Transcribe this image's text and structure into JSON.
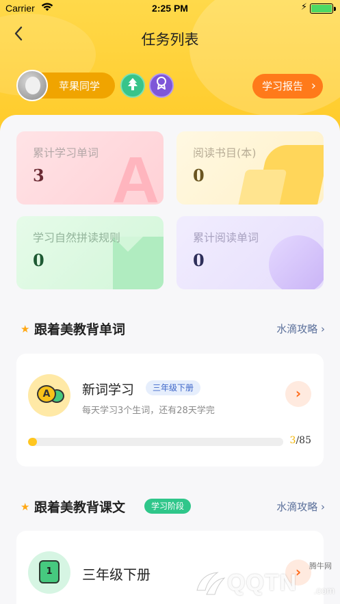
{
  "status_bar": {
    "carrier": "Carrier",
    "time": "2:25 PM"
  },
  "nav": {
    "back_icon": "chevron-left-icon",
    "title": "任务列表"
  },
  "profile": {
    "name": "苹果同学",
    "report_label": "学习报告"
  },
  "stats": [
    {
      "label": "累计学习单词",
      "value": "3"
    },
    {
      "label": "阅读书目(本)",
      "value": "0"
    },
    {
      "label": "学习自然拼读规则",
      "value": "0"
    },
    {
      "label": "累计阅读单词",
      "value": "0"
    }
  ],
  "section_words": {
    "title": "跟着美教背单词",
    "link": "水滴攻略"
  },
  "word_card": {
    "title": "新词学习",
    "grade": "三年级下册",
    "subtitle": "每天学习3个生词，还有28天学完",
    "progress_current": "3",
    "progress_total": "/85",
    "progress_fraction": 0.035
  },
  "section_texts": {
    "title": "跟着美教背课文",
    "tag": "学习阶段",
    "link": "水滴攻略"
  },
  "text_card": {
    "title": "三年级下册",
    "icon_label": "1"
  },
  "watermark": {
    "site": "腾牛网",
    "brand": "QQTN",
    "suffix": ".com"
  },
  "colors": {
    "accent": "#ffc61f",
    "orange": "#ff7a1a",
    "green": "#2fc68a"
  }
}
